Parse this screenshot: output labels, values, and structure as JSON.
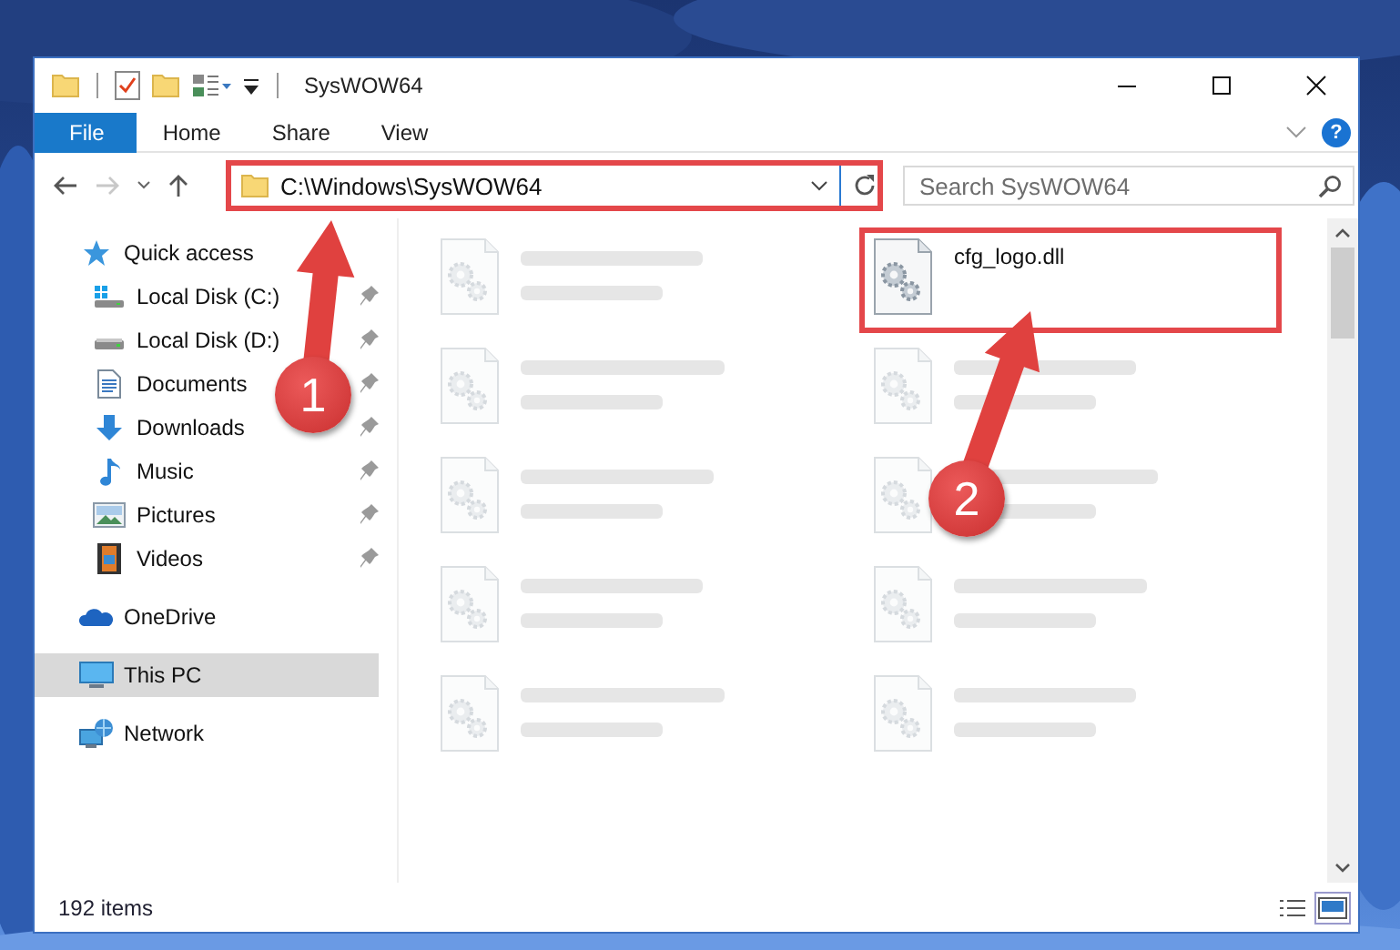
{
  "window": {
    "title": "SysWOW64"
  },
  "ribbon": {
    "tabs": [
      {
        "label": "File",
        "kind": "file"
      },
      {
        "label": "Home",
        "kind": "tab"
      },
      {
        "label": "Share",
        "kind": "tab"
      },
      {
        "label": "View",
        "kind": "tab"
      }
    ],
    "help": "?"
  },
  "address_bar": {
    "value": "C:\\Windows\\SysWOW64",
    "highlighted": true,
    "forward_disabled": true
  },
  "search": {
    "placeholder": "Search SysWOW64"
  },
  "sidebar": {
    "items": [
      {
        "label": "Quick access",
        "kind": "star",
        "selected": false,
        "children": [
          {
            "label": "Local Disk (C:)",
            "kind": "system-drive",
            "pinned": true,
            "selected": false
          },
          {
            "label": "Local Disk (D:)",
            "kind": "drive",
            "pinned": true,
            "selected": false
          },
          {
            "label": "Documents",
            "kind": "documents",
            "pinned": true,
            "selected": false
          },
          {
            "label": "Downloads",
            "kind": "downloads",
            "pinned": true,
            "selected": false
          },
          {
            "label": "Music",
            "kind": "music",
            "pinned": true,
            "selected": false
          },
          {
            "label": "Pictures",
            "kind": "pictures",
            "pinned": true,
            "selected": false
          },
          {
            "label": "Videos",
            "kind": "videos",
            "pinned": true,
            "selected": false
          }
        ]
      },
      {
        "label": "OneDrive",
        "kind": "cloud",
        "selected": false
      },
      {
        "label": "This PC",
        "kind": "pc",
        "selected": true
      },
      {
        "label": "Network",
        "kind": "network",
        "selected": false
      }
    ]
  },
  "files": [
    {
      "kind": "blurred",
      "highlighted": false
    },
    {
      "kind": "file",
      "name": "cfg_logo.dll",
      "highlighted": true
    },
    {
      "kind": "blurred",
      "highlighted": false
    },
    {
      "kind": "blurred",
      "highlighted": false
    },
    {
      "kind": "blurred",
      "highlighted": false
    },
    {
      "kind": "blurred",
      "highlighted": false
    },
    {
      "kind": "blurred",
      "highlighted": false
    },
    {
      "kind": "blurred",
      "highlighted": false
    },
    {
      "kind": "blurred",
      "highlighted": false
    },
    {
      "kind": "blurred",
      "highlighted": false
    }
  ],
  "status_bar": {
    "count": "192 items",
    "views": [
      {
        "kind": "details",
        "selected": false
      },
      {
        "kind": "large-icons",
        "selected": true
      }
    ]
  },
  "annotations": [
    {
      "number": "1"
    },
    {
      "number": "2"
    }
  ]
}
